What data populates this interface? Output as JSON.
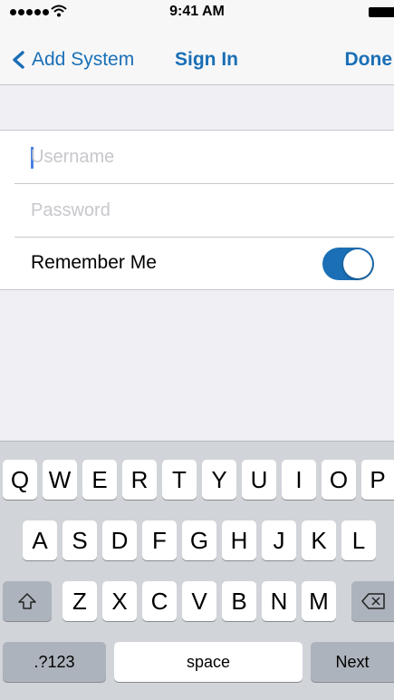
{
  "status_bar": {
    "time": "9:41 AM"
  },
  "nav": {
    "back_label": "Add System",
    "title": "Sign In",
    "done_label": "Done"
  },
  "form": {
    "username": {
      "placeholder": "Username",
      "value": ""
    },
    "password": {
      "placeholder": "Password",
      "value": ""
    },
    "remember": {
      "label": "Remember Me",
      "on": true
    }
  },
  "keyboard": {
    "row1": [
      "Q",
      "W",
      "E",
      "R",
      "T",
      "Y",
      "U",
      "I",
      "O",
      "P"
    ],
    "row2": [
      "A",
      "S",
      "D",
      "F",
      "G",
      "H",
      "J",
      "K",
      "L"
    ],
    "row3": [
      "Z",
      "X",
      "C",
      "V",
      "B",
      "N",
      "M"
    ],
    "numbers_label": ".?123",
    "space_label": "space",
    "next_label": "Next"
  },
  "colors": {
    "accent": "#1a6fb5",
    "background": "#efeff4",
    "keyboard": "#d1d4d9"
  }
}
